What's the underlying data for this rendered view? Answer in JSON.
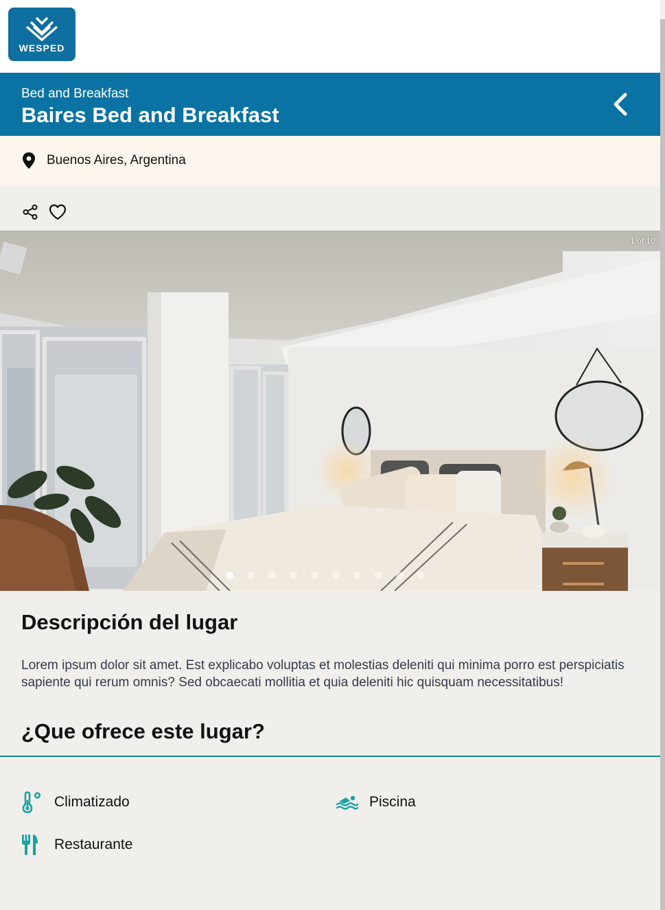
{
  "brand": {
    "logo_text": "WESPED",
    "color": "#0e6fa0"
  },
  "header": {
    "category": "Bed and Breakfast",
    "title": "Baires Bed and Breakfast",
    "bg_color": "#0b73a3"
  },
  "location": {
    "text": "Buenos Aires, Argentina"
  },
  "actions": {
    "share_icon": "share-icon",
    "favorite_icon": "heart-icon"
  },
  "gallery": {
    "counter": "1 of 10",
    "total": 10,
    "current": 1
  },
  "description": {
    "title": "Descripción del lugar",
    "text": "Lorem ipsum dolor sit amet. Est explicabo voluptas et molestias deleniti qui minima porro est perspiciatis sapiente qui rerum omnis? Sed obcaecati mollitia et quia deleniti hic quisquam necessitatibus!"
  },
  "offers": {
    "title": "¿Que ofrece este lugar?",
    "accent_color": "#1aa3a3",
    "items": [
      {
        "label": "Climatizado",
        "icon": "thermometer-icon"
      },
      {
        "label": "Piscina",
        "icon": "swimming-icon"
      },
      {
        "label": "Restaurante",
        "icon": "utensils-icon"
      }
    ]
  }
}
